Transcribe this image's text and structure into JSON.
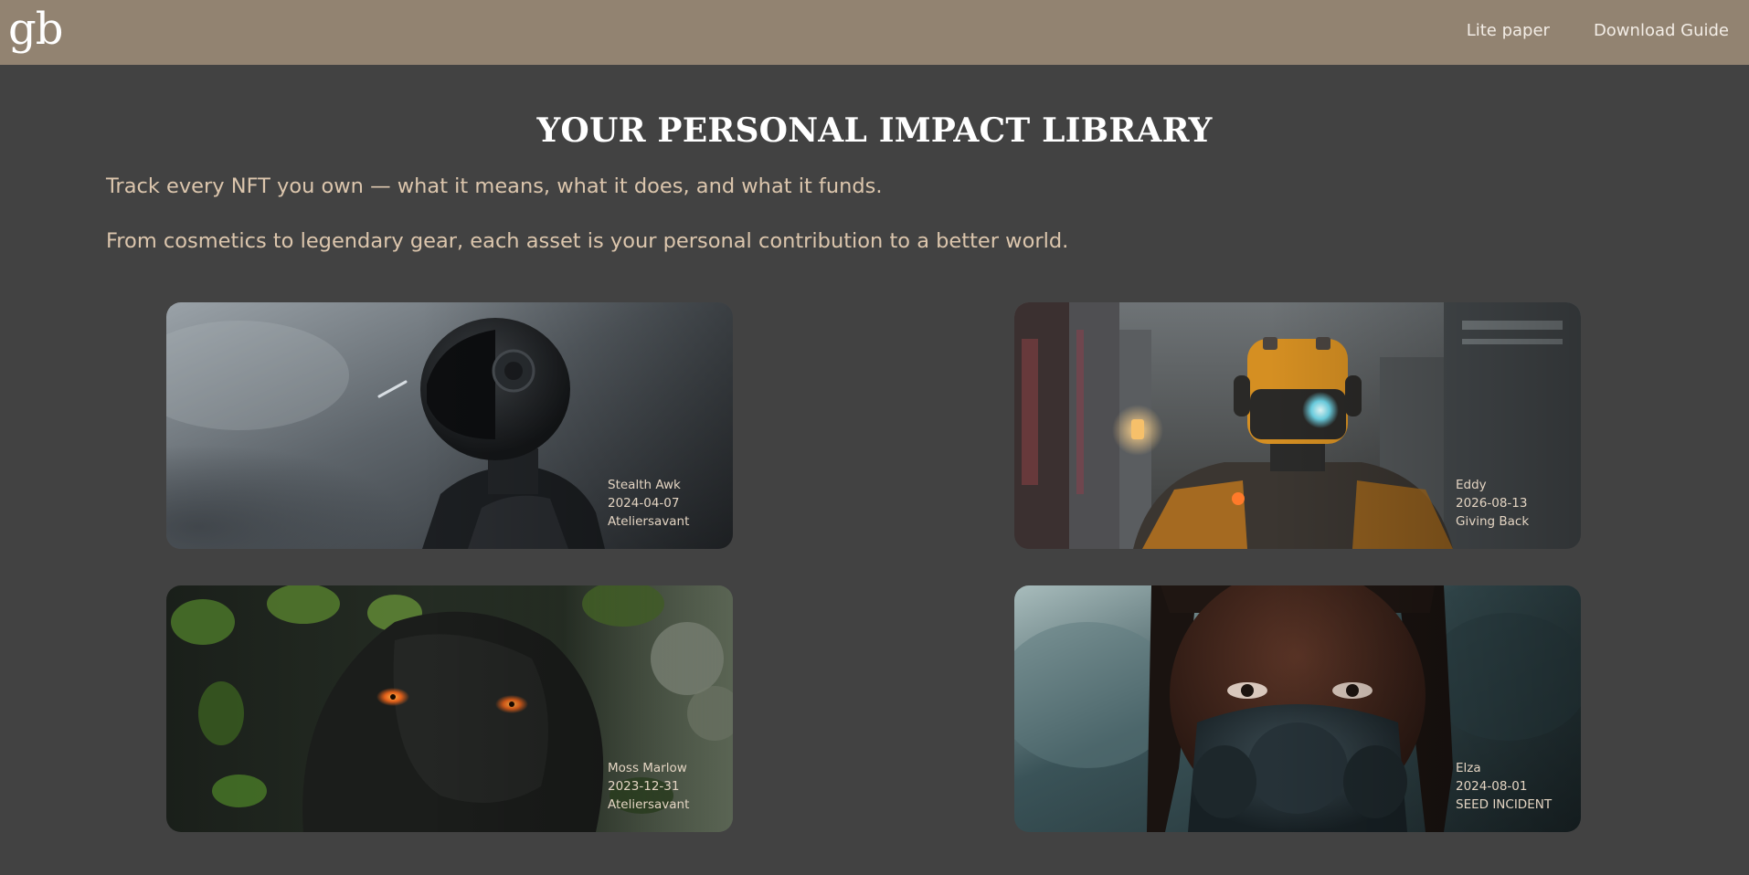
{
  "header": {
    "logo": "gb",
    "nav": [
      {
        "label": "Lite paper"
      },
      {
        "label": "Download Guide"
      }
    ]
  },
  "main": {
    "title": "YOUR PERSONAL IMPACT LIBRARY",
    "intro_lines": [
      "Track every NFT you own — what it means, what it does, and what it funds.",
      "From cosmetics to legendary gear, each asset is your personal contribution to a better world."
    ],
    "cards": [
      {
        "name": "Stealth Awk",
        "date": "2024-04-07",
        "creator": "Ateliersavant",
        "art": "helmeted-robot-in-fog"
      },
      {
        "name": "Eddy",
        "date": "2026-08-13",
        "creator": "Giving Back",
        "art": "orange-robot-in-city"
      },
      {
        "name": "Moss Marlow",
        "date": "2023-12-31",
        "creator": "Ateliersavant",
        "art": "moss-creature-glowing-eyes"
      },
      {
        "name": "Elza",
        "date": "2024-08-01",
        "creator": "SEED INCIDENT",
        "art": "woman-with-gas-mask"
      }
    ]
  },
  "colors": {
    "topbar": "#928371",
    "background": "#424242",
    "intro_text": "#dcc6ad",
    "title_text": "#ffffff"
  }
}
